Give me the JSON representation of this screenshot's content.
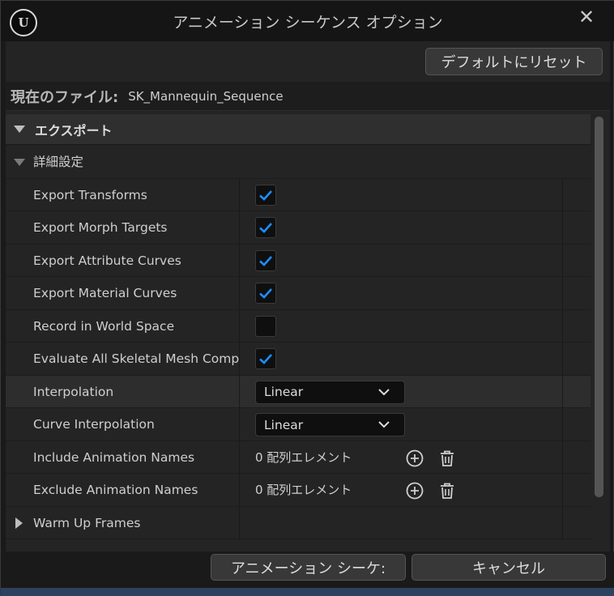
{
  "window": {
    "title": "アニメーション シーケンス オプション",
    "close_icon": "close-icon",
    "logo_text": "U"
  },
  "toolbar": {
    "reset_label": "デフォルトにリセット"
  },
  "current_file": {
    "label": "現在のファイル:",
    "value": "SK_Mannequin_Sequence"
  },
  "section": {
    "label": "エクスポート"
  },
  "group": {
    "label": "詳細設定"
  },
  "rows": [
    {
      "label": "Export Transforms",
      "checked": true
    },
    {
      "label": "Export Morph Targets",
      "checked": true
    },
    {
      "label": "Export Attribute Curves",
      "checked": true
    },
    {
      "label": "Export Material Curves",
      "checked": true
    },
    {
      "label": "Record in World Space",
      "checked": false
    },
    {
      "label": "Evaluate All Skeletal Mesh Compo...",
      "checked": true
    }
  ],
  "interpolation": {
    "label": "Interpolation",
    "value": "Linear"
  },
  "curve_interpolation": {
    "label": "Curve Interpolation",
    "value": "Linear"
  },
  "include_names": {
    "label": "Include Animation Names",
    "value": "0 配列エレメント"
  },
  "exclude_names": {
    "label": "Exclude Animation Names",
    "value": "0 配列エレメント"
  },
  "warm_up": {
    "label": "Warm Up Frames"
  },
  "footer": {
    "ok_label": "アニメーション シーケ:",
    "cancel_label": "キャンセル"
  },
  "colors": {
    "check_accent": "#1a8fff",
    "panel_bg": "#242424"
  }
}
